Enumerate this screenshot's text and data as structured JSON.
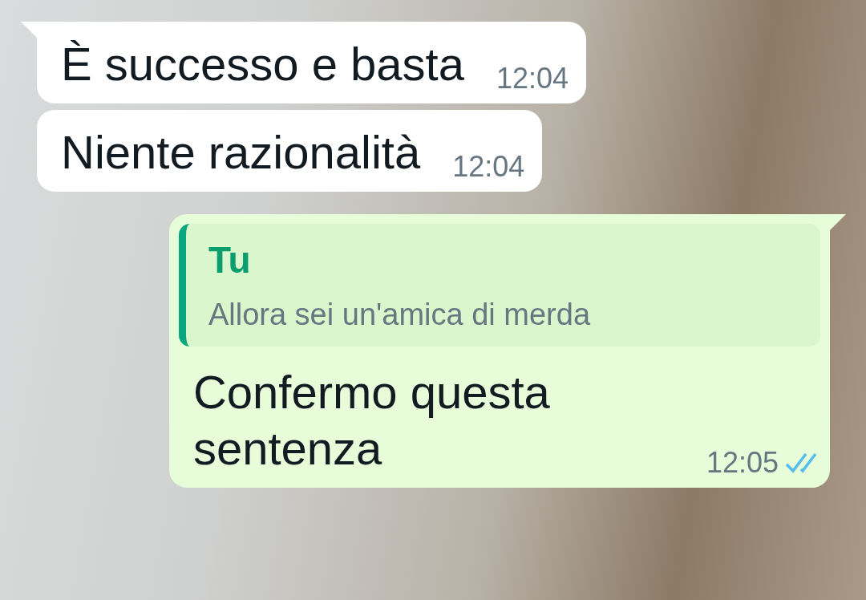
{
  "messages": [
    {
      "kind": "incoming",
      "tail": true,
      "text": "È successo e basta",
      "time": "12:04"
    },
    {
      "kind": "incoming",
      "tail": false,
      "text": "Niente razionalità",
      "time": "12:04"
    },
    {
      "kind": "outgoing",
      "tail": true,
      "reply": {
        "author": "Tu",
        "text": "Allora sei un'amica di merda"
      },
      "text": "Confermo questa sentenza",
      "time": "12:05",
      "read": true
    }
  ]
}
